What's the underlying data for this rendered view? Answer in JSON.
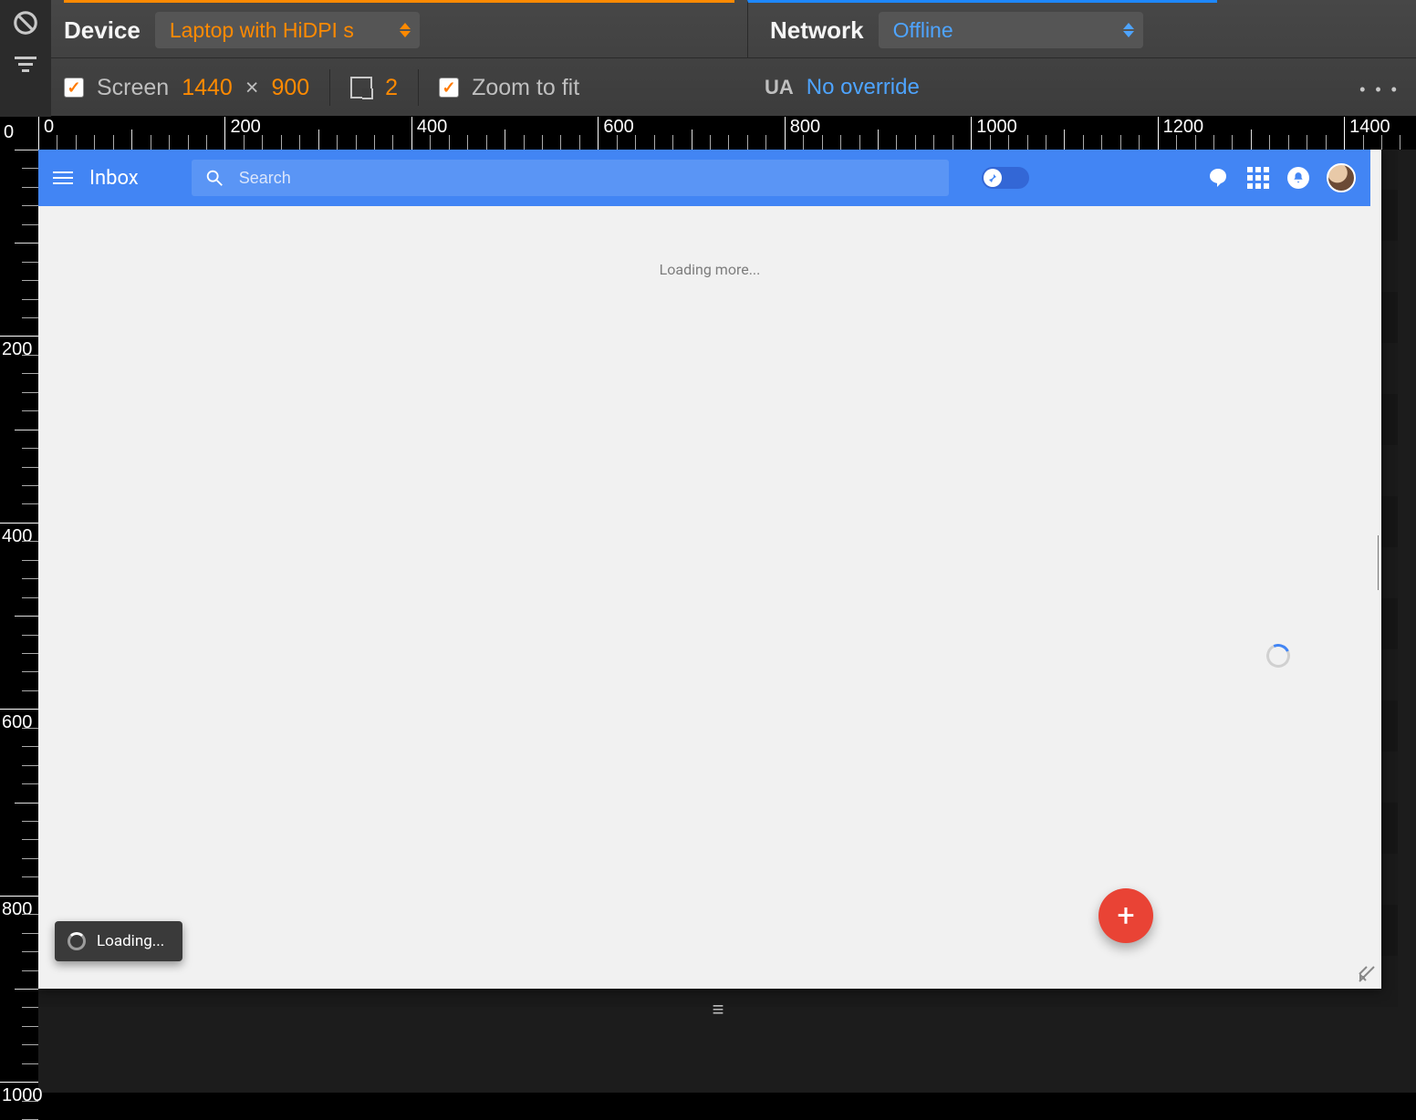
{
  "devtools": {
    "device_label": "Device",
    "device_value": "Laptop with HiDPI s",
    "network_label": "Network",
    "network_value": "Offline",
    "screen_label": "Screen",
    "screen_width": "1440",
    "screen_times": "×",
    "screen_height": "900",
    "dpr_value": "2",
    "zoom_label": "Zoom to fit",
    "ua_label": "UA",
    "ua_value": "No override",
    "ruler_zero": "0",
    "ruler_h": [
      "0",
      "200",
      "400",
      "600",
      "800",
      "1000",
      "1200",
      "1400"
    ],
    "ruler_v": [
      "200",
      "400",
      "600",
      "800",
      "1000"
    ]
  },
  "inbox": {
    "title": "Inbox",
    "search_placeholder": "Search",
    "loading_more": "Loading more...",
    "toast": "Loading...",
    "fab_plus": "+"
  }
}
